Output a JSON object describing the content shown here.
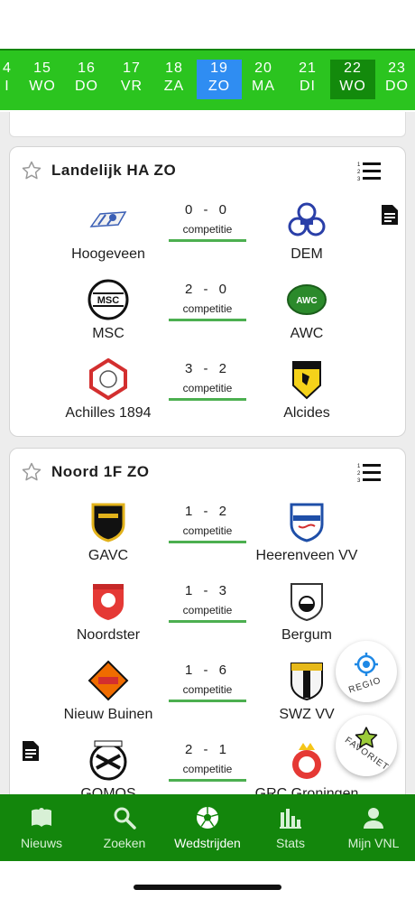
{
  "date_strip": {
    "items": [
      {
        "num": "4",
        "day": "I"
      },
      {
        "num": "15",
        "day": "WO"
      },
      {
        "num": "16",
        "day": "DO"
      },
      {
        "num": "17",
        "day": "VR"
      },
      {
        "num": "18",
        "day": "ZA"
      },
      {
        "num": "19",
        "day": "ZO"
      },
      {
        "num": "20",
        "day": "MA"
      },
      {
        "num": "21",
        "day": "DI"
      },
      {
        "num": "22",
        "day": "WO"
      },
      {
        "num": "23",
        "day": "DO"
      }
    ],
    "selected_color": "#2f8df2",
    "today_color": "#138a0c"
  },
  "leagues": [
    {
      "title": "Landelijk HA ZO",
      "matches": [
        {
          "home": "Hoogeveen",
          "away": "DEM",
          "score": "0 - 0",
          "type": "competitie"
        },
        {
          "home": "MSC",
          "away": "AWC",
          "score": "2 - 0",
          "type": "competitie"
        },
        {
          "home": "Achilles 1894",
          "away": "Alcides",
          "score": "3 - 2",
          "type": "competitie"
        }
      ]
    },
    {
      "title": "Noord 1F ZO",
      "matches": [
        {
          "home": "GAVC",
          "away": "Heerenveen VV",
          "score": "1 - 2",
          "type": "competitie"
        },
        {
          "home": "Noordster",
          "away": "Bergum",
          "score": "1 - 3",
          "type": "competitie"
        },
        {
          "home": "Nieuw Buinen",
          "away": "SWZ VV",
          "score": "1 - 6",
          "type": "competitie"
        },
        {
          "home": "GOMOS",
          "away": "GRC Groningen",
          "score": "2 - 1",
          "type": "competitie"
        }
      ]
    }
  ],
  "fabs": {
    "regio": "REGIO",
    "favoriet": "FAVORIET"
  },
  "bottom_nav": {
    "items": [
      {
        "label": "Nieuws",
        "icon": "book-icon"
      },
      {
        "label": "Zoeken",
        "icon": "search-icon"
      },
      {
        "label": "Wedstrijden",
        "icon": "soccer-ball-icon"
      },
      {
        "label": "Stats",
        "icon": "bar-chart-icon"
      },
      {
        "label": "Mijn VNL",
        "icon": "person-icon"
      }
    ],
    "active": "Wedstrijden"
  },
  "colors": {
    "brand_green": "#2bc41f",
    "dark_green": "#13860c",
    "underline_green": "#4caf50"
  }
}
